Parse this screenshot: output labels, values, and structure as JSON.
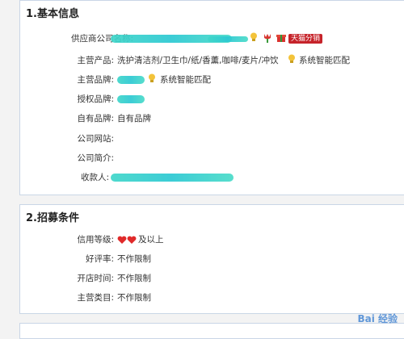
{
  "basic": {
    "title": "1.基本信息",
    "rows": [
      {
        "label": "供应商公司名称:",
        "value": "",
        "badge": "天猫分销"
      },
      {
        "label": "主营产品:",
        "value": "洗护清洁剂/卫生巾/纸/香薰,咖啡/麦片/冲饮",
        "tag": "系统智能匹配"
      },
      {
        "label": "主营品牌:",
        "value": "",
        "tag": "系统智能匹配"
      },
      {
        "label": "授权品牌:",
        "value": ""
      },
      {
        "label": "自有品牌:",
        "value": "自有品牌"
      },
      {
        "label": "公司网站:",
        "value": ""
      },
      {
        "label": "公司简介:",
        "value": ""
      },
      {
        "label": "收款人:",
        "value": ""
      }
    ]
  },
  "recruit": {
    "title": "2.招募条件",
    "rows": [
      {
        "label": "信用等级:",
        "value": "及以上"
      },
      {
        "label": "好评率:",
        "value": "不作限制"
      },
      {
        "label": "开店时间:",
        "value": "不作限制"
      },
      {
        "label": "主营类目:",
        "value": "不作限制"
      }
    ]
  },
  "watermark": "Bai 经验",
  "colors": {
    "border": "#c9d6e6",
    "badge": "#c6232a",
    "redact": "#2bc8d2",
    "heart": "#e02a2a"
  }
}
